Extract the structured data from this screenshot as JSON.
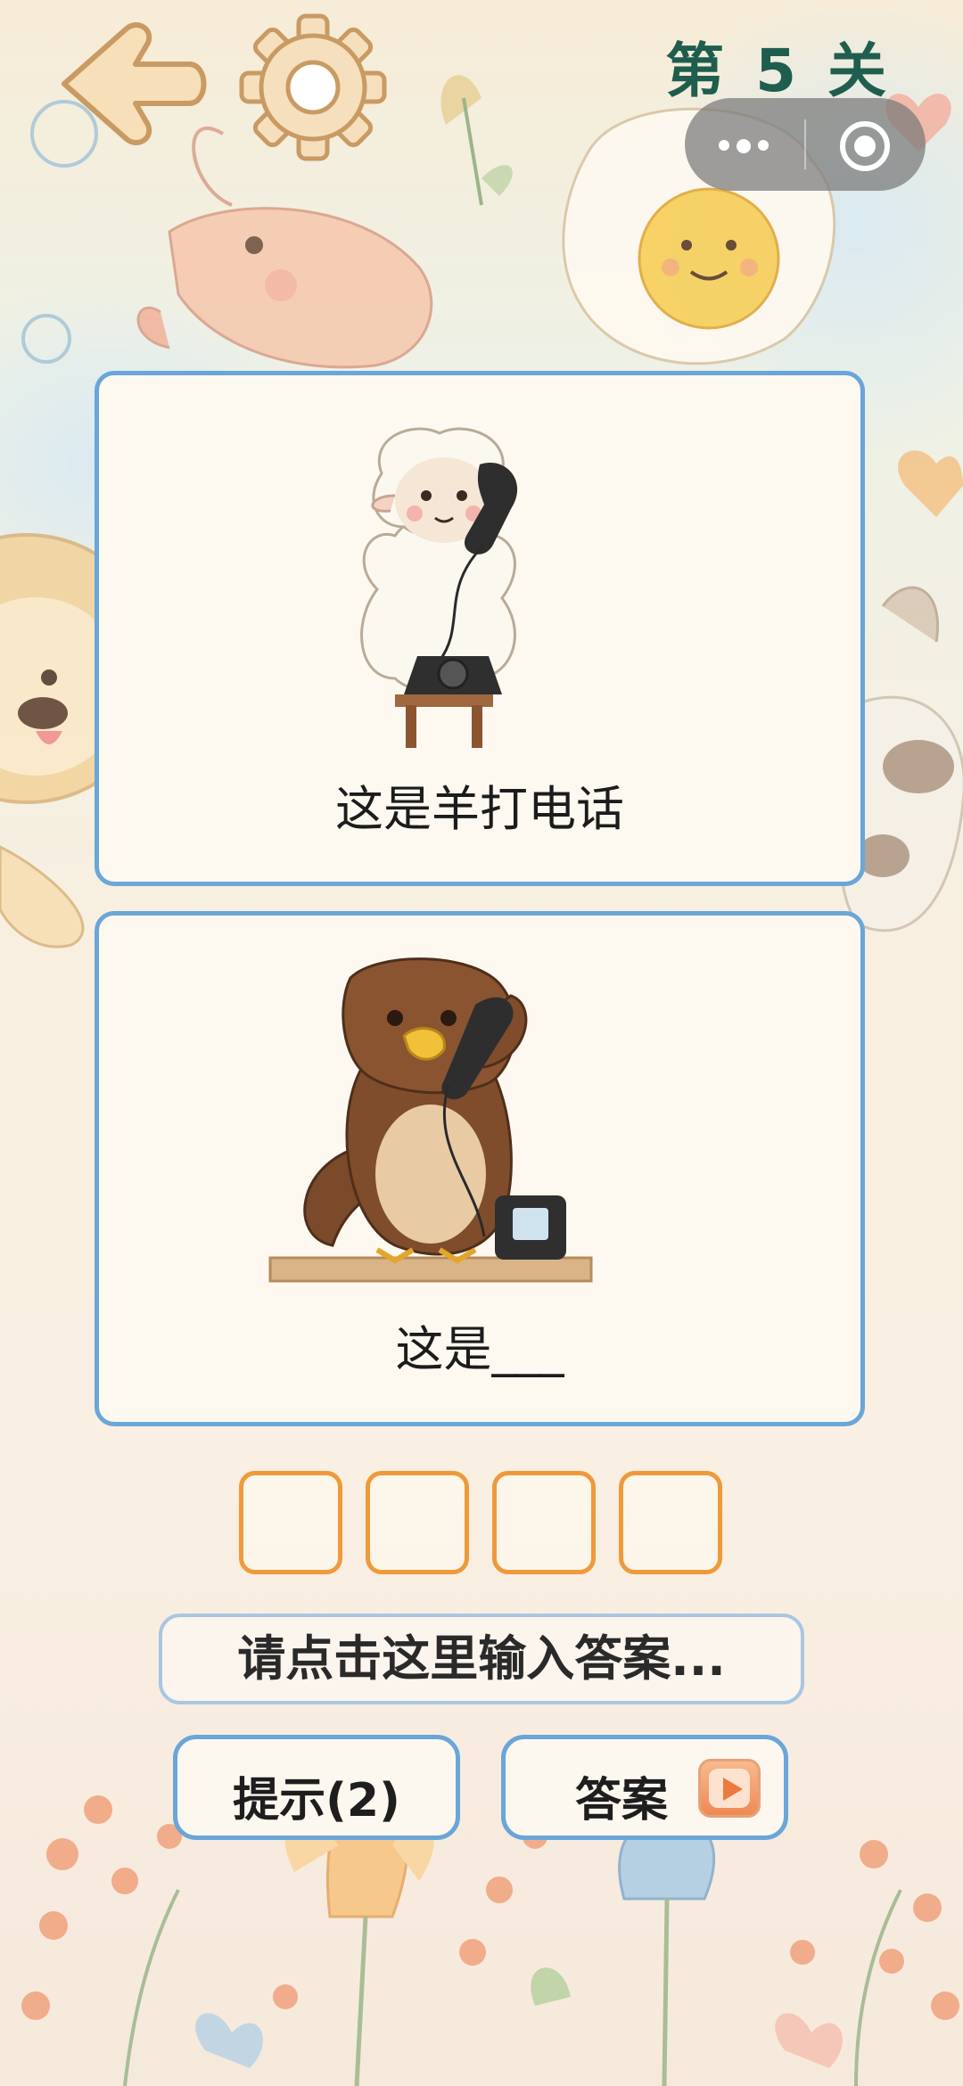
{
  "header": {
    "level_title": "第 5 关"
  },
  "cards": [
    {
      "caption": "这是羊打电话",
      "illustration": "sheep-on-phone"
    },
    {
      "caption": "这是___",
      "illustration": "eagle-on-phone"
    }
  ],
  "answer": {
    "box_count": 4,
    "input_placeholder": "请点击这里输入答案..."
  },
  "buttons": {
    "hint_label": "提示(2)",
    "answer_label": "答案"
  },
  "colors": {
    "card_border": "#6aa6d8",
    "answer_box_border": "#ef9a3a",
    "level_title": "#1f5e4e"
  }
}
